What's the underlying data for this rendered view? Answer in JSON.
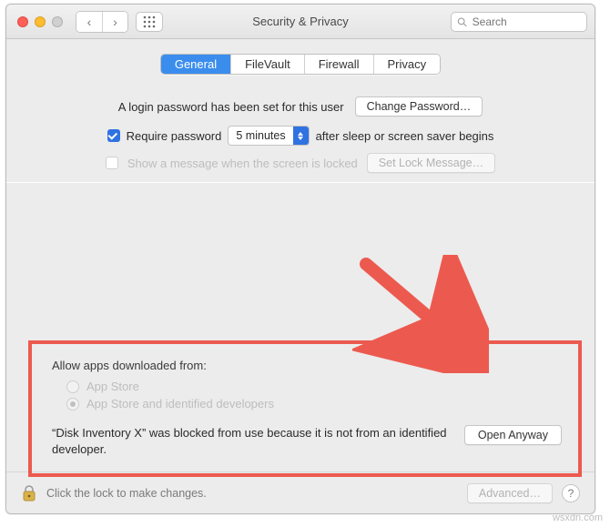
{
  "titlebar": {
    "title": "Security & Privacy",
    "search_placeholder": "Search"
  },
  "tabs": {
    "general": "General",
    "filevault": "FileVault",
    "firewall": "Firewall",
    "privacy": "Privacy",
    "active": "general"
  },
  "general": {
    "login_pw_text": "A login password has been set for this user",
    "change_password_btn": "Change Password…",
    "require_password_label": "Require password",
    "require_password_checked": true,
    "delay_value": "5 minutes",
    "delay_suffix": "after sleep or screen saver begins",
    "show_message_label": "Show a message when the screen is locked",
    "show_message_checked": false,
    "set_lock_message_btn": "Set Lock Message…"
  },
  "allow": {
    "heading": "Allow apps downloaded from:",
    "option_app_store": "App Store",
    "option_identified": "App Store and identified developers",
    "selected": "identified",
    "blocked_message": "“Disk Inventory X” was blocked from use because it is not from an identified developer.",
    "open_anyway_btn": "Open Anyway"
  },
  "footer": {
    "lock_text": "Click the lock to make changes.",
    "advanced_btn": "Advanced…",
    "help": "?"
  },
  "watermark": "wsxdn.com",
  "colors": {
    "accent": "#2f72e2",
    "highlight": "#ec5a4f"
  }
}
